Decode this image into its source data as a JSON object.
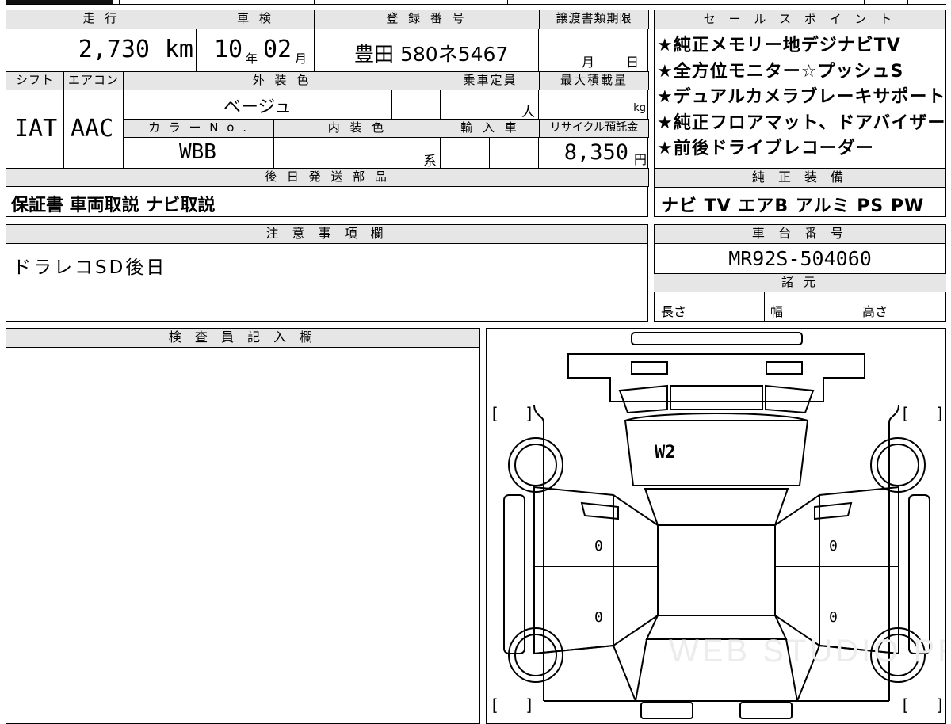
{
  "top_sheet": {
    "labels": {
      "mileage": "走 行",
      "inspection": "車 検",
      "registration": "登 録 番 号",
      "transfer_deadline": "譲渡書類期限",
      "shift": "シフト",
      "aircon": "エアコン",
      "exterior_color": "外 装 色",
      "capacity": "乗車定員",
      "max_load": "最大積載量",
      "color_no": "カ ラ ー N o .",
      "interior_color": "内 装 色",
      "imported": "輸 入 車",
      "recycle_fee": "リサイクル預託金",
      "later_parts": "後 日 発 送 部 品"
    },
    "values": {
      "mileage": "2,730",
      "mileage_unit": "km",
      "inspection_year": "10",
      "year_unit": "年",
      "inspection_month": "02",
      "month_unit": "月",
      "registration_no": "豊田 580ネ5467",
      "deadline_month_unit": "月",
      "deadline_day_unit": "日",
      "shift": "IAT",
      "aircon": "AAC",
      "exterior_color": "ベージュ",
      "capacity_unit": "人",
      "load_unit": "kg",
      "color_no": "WBB",
      "interior_unit": "系",
      "recycle_fee": "8,350",
      "yen_unit": "円",
      "later_parts": "保証書 車両取説 ナビ取説"
    }
  },
  "sales_points": {
    "header": "セ ー ル ス ポ イ ン ト",
    "items": [
      "★純正メモリー地デジナビTV",
      "★全方位モニター☆プッシュS",
      "★デュアルカメラブレーキサポート",
      "★純正フロアマット、ドアバイザー",
      "★前後ドライブレコーダー"
    ]
  },
  "equipment": {
    "header": "純 正 装 備",
    "value": "ナビ TV エアB アルミ PS PW"
  },
  "notes": {
    "header": "注 意 事 項 欄",
    "value": "ドラレコSD後日"
  },
  "chassis": {
    "header": "車 台 番 号",
    "value": "MR92S-504060"
  },
  "specs": {
    "header": "諸 元",
    "length": "長さ",
    "width": "幅",
    "height": "高さ"
  },
  "inspector": {
    "header": "検 査 員 記 入 欄"
  },
  "diagram": {
    "hood_mark": "W2",
    "door_marks": [
      "0",
      "0",
      "0",
      "0"
    ],
    "watermark": "WEB STUDIO PRO"
  }
}
